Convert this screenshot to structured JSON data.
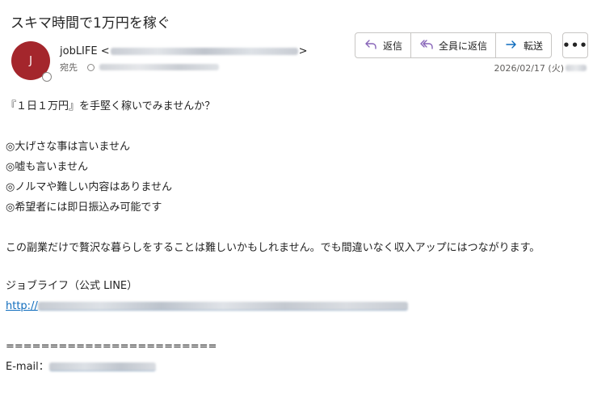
{
  "email": {
    "subject": "スキマ時間で1万円を稼ぐ",
    "avatar_initial": "J",
    "sender_name": "jobLIFE <",
    "sender_close": ">",
    "to_label": "宛先",
    "date": "2026/02/17 (火)",
    "more_label": "•••"
  },
  "actions": {
    "reply": "返信",
    "reply_all": "全員に返信",
    "forward": "転送"
  },
  "body": {
    "intro": "『１日１万円』を手堅く稼いでみませんか？",
    "points": [
      "◎大げさな事は言いません",
      "◎嘘も言いません",
      "◎ノルマや難しい内容はありません",
      "◎希望者には即日振込み可能です"
    ],
    "paragraph": "この副業だけで贅沢な暮らしをすることは難しいかもしれません。でも間違いなく収入アップにはつながります。",
    "line_label": "ジョブライフ（公式 LINE）",
    "link_prefix": "http://",
    "separator": "========================",
    "email_label": "E-mail："
  },
  "colors": {
    "avatar_bg": "#a4262c",
    "reply_icon": "#8764b8",
    "forward_icon": "#0f6cbd",
    "link": "#0f6cbd"
  },
  "icons": {
    "reply": "reply-arrow-icon",
    "reply_all": "reply-all-arrow-icon",
    "forward": "forward-arrow-icon",
    "more": "more-dots-icon"
  }
}
